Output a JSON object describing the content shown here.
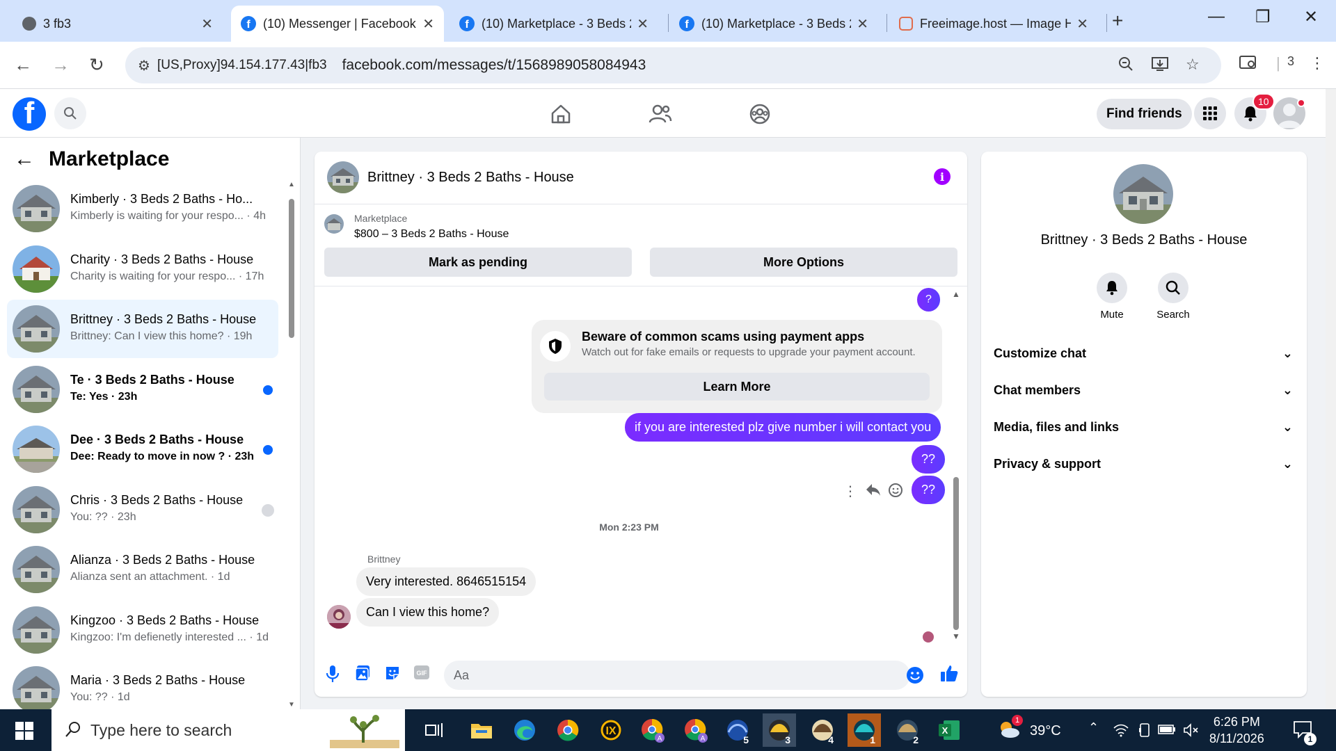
{
  "browser": {
    "tabs": [
      {
        "title": "3 fb3",
        "icon": "globe-icon"
      },
      {
        "title": "(10) Messenger | Facebook",
        "icon": "facebook-icon"
      },
      {
        "title": "(10) Marketplace - 3 Beds 2",
        "icon": "facebook-icon"
      },
      {
        "title": "(10) Marketplace - 3 Beds 2",
        "icon": "facebook-icon"
      },
      {
        "title": "Freeimage.host — Image Ho",
        "icon": "image-host-icon"
      }
    ],
    "new_tab": "+",
    "window_controls": {
      "minimize": "—",
      "restore": "❐",
      "close": "✕"
    },
    "address": {
      "proxy_label": "[US,Proxy]94.154.177.43|fb3",
      "url": "facebook.com/messages/t/1568989058084943"
    },
    "profile_count": "3"
  },
  "fb_header": {
    "find_friends": "Find friends",
    "notification_count": "10"
  },
  "sidebar": {
    "title": "Marketplace",
    "conversations": [
      {
        "name": "Kimberly · 3 Beds 2 Baths - Ho...",
        "preview": "Kimberly is waiting for your respo... · 4h",
        "unread": false,
        "thumb": "house-gray"
      },
      {
        "name": "Charity · 3 Beds 2 Baths - House",
        "preview": "Charity is waiting for your respo... · 17h",
        "unread": false,
        "thumb": "house-white"
      },
      {
        "name": "Brittney · 3 Beds 2 Baths - House",
        "preview": "Brittney: Can I view this home? · 19h",
        "unread": false,
        "thumb": "house-gray"
      },
      {
        "name": "Te · 3 Beds 2 Baths - House",
        "preview": "Te: Yes · 23h",
        "unread": true,
        "thumb": "house-gray"
      },
      {
        "name": "Dee · 3 Beds 2 Baths - House",
        "preview": "Dee: Ready to move in now ? · 23h",
        "unread": true,
        "thumb": "house-stone"
      },
      {
        "name": "Chris · 3 Beds 2 Baths - House",
        "preview": "You: ?? · 23h",
        "unread": false,
        "thumb": "house-gray"
      },
      {
        "name": "Alianza · 3 Beds 2 Baths - House",
        "preview": "Alianza sent an attachment. · 1d",
        "unread": false,
        "thumb": "house-gray"
      },
      {
        "name": "Kingzoo · 3 Beds 2 Baths - House",
        "preview": "Kingzoo: I'm defienetly interested ... · 1d",
        "unread": false,
        "thumb": "house-gray"
      },
      {
        "name": "Maria · 3 Beds 2 Baths - House",
        "preview": "You: ?? · 1d",
        "unread": false,
        "thumb": "house-gray"
      }
    ]
  },
  "chat": {
    "title": "Brittney · 3 Beds 2 Baths - House",
    "listing": {
      "source": "Marketplace",
      "title": "$800 – 3 Beds 2 Baths - House",
      "mark_pending": "Mark as pending",
      "more_options": "More Options"
    },
    "messages": {
      "out_question": "?",
      "scam_title": "Beware of common scams using payment apps",
      "scam_body": "Watch out for fake emails or requests to upgrade your payment account.",
      "learn_more": "Learn More",
      "out_interested": "if you are interested plz give number i will contact you",
      "out_qq1": "??",
      "out_qq2": "??",
      "timestamp": "Mon 2:23 PM",
      "sender": "Brittney",
      "in_1": "Very interested. 8646515154",
      "in_2": "Can I view this home?"
    },
    "composer_placeholder": "Aa"
  },
  "info_panel": {
    "name": "Brittney · 3 Beds 2 Baths - House",
    "mute": "Mute",
    "search": "Search",
    "sections": [
      "Customize chat",
      "Chat members",
      "Media, files and links",
      "Privacy & support"
    ]
  },
  "taskbar": {
    "search_placeholder": "Type here to search",
    "weather": "39°C",
    "time": "6:26 PM",
    "date": "8/11/2026",
    "app_badges": [
      "5",
      "3",
      "4",
      "1",
      "2"
    ],
    "weather_badge": "1",
    "notif_count": "1"
  }
}
